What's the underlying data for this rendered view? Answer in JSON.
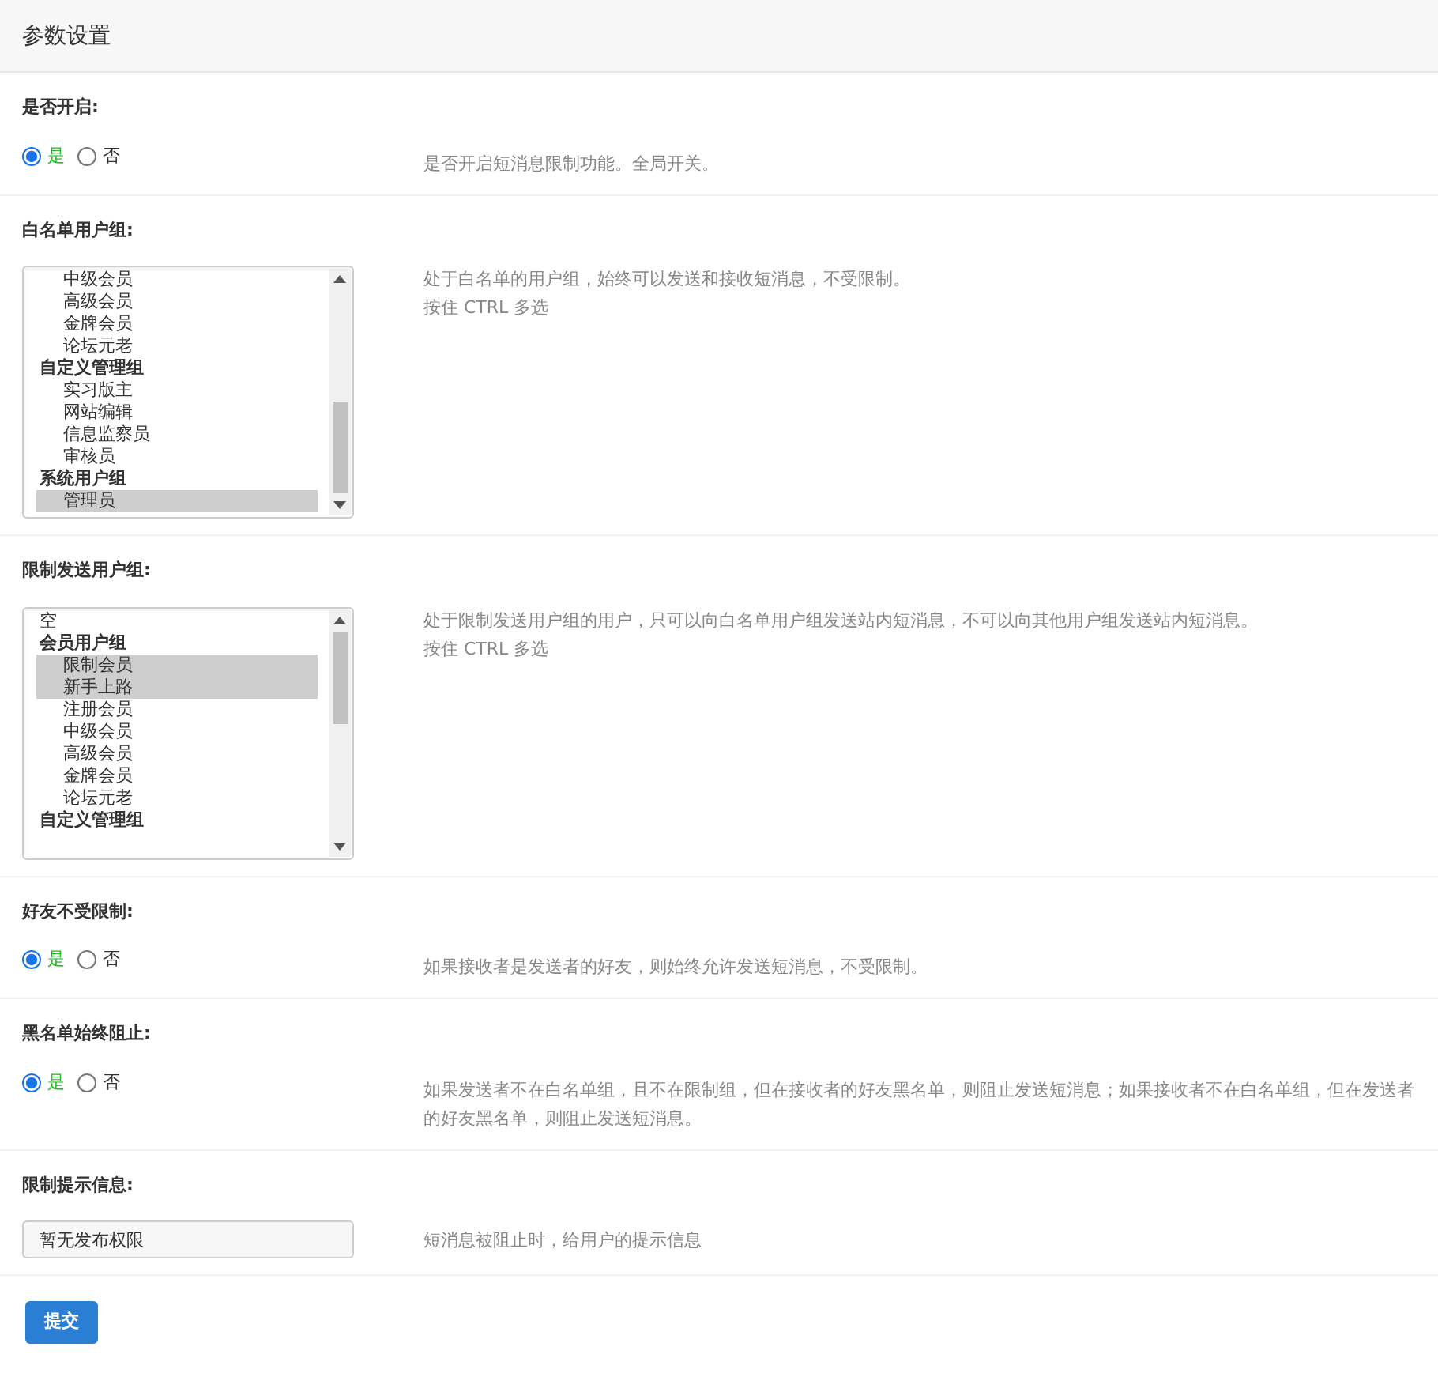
{
  "panel_title": "参数设置",
  "settings": [
    {
      "kind": "radio",
      "label": "是否开启:",
      "options": [
        {
          "label": "是",
          "selected": true
        },
        {
          "label": "否",
          "selected": false
        }
      ],
      "description": [
        "是否开启短消息限制功能。全局开关。"
      ]
    },
    {
      "kind": "listbox",
      "label": "白名单用户组:",
      "items": [
        {
          "kind": "option",
          "label": "中级会员",
          "selected": false
        },
        {
          "kind": "option",
          "label": "高级会员",
          "selected": false
        },
        {
          "kind": "option",
          "label": "金牌会员",
          "selected": false
        },
        {
          "kind": "option",
          "label": "论坛元老",
          "selected": false
        },
        {
          "kind": "group",
          "label": "自定义管理组",
          "selected": false
        },
        {
          "kind": "option",
          "label": "实习版主",
          "selected": false
        },
        {
          "kind": "option",
          "label": "网站编辑",
          "selected": false
        },
        {
          "kind": "option",
          "label": "信息监察员",
          "selected": false
        },
        {
          "kind": "option",
          "label": "审核员",
          "selected": false
        },
        {
          "kind": "group",
          "label": "系统用户组",
          "selected": false
        },
        {
          "kind": "option",
          "label": "管理员",
          "selected": true
        }
      ],
      "description": [
        "处于白名单的用户组，始终可以发送和接收短消息，不受限制。",
        "按住 CTRL 多选"
      ]
    },
    {
      "kind": "listbox",
      "label": "限制发送用户组:",
      "items": [
        {
          "kind": "plain",
          "label": "空",
          "selected": false
        },
        {
          "kind": "group",
          "label": "会员用户组",
          "selected": false
        },
        {
          "kind": "option",
          "label": "限制会员",
          "selected": true
        },
        {
          "kind": "option",
          "label": "新手上路",
          "selected": true
        },
        {
          "kind": "option",
          "label": "注册会员",
          "selected": false
        },
        {
          "kind": "option",
          "label": "中级会员",
          "selected": false
        },
        {
          "kind": "option",
          "label": "高级会员",
          "selected": false
        },
        {
          "kind": "option",
          "label": "金牌会员",
          "selected": false
        },
        {
          "kind": "option",
          "label": "论坛元老",
          "selected": false
        },
        {
          "kind": "group",
          "label": "自定义管理组",
          "selected": false
        }
      ],
      "description": [
        "处于限制发送用户组的用户，只可以向白名单用户组发送站内短消息，不可以向其他用户组发送站内短消息。",
        "按住 CTRL 多选"
      ]
    },
    {
      "kind": "radio",
      "label": "好友不受限制:",
      "options": [
        {
          "label": "是",
          "selected": true
        },
        {
          "label": "否",
          "selected": false
        }
      ],
      "description": [
        "如果接收者是发送者的好友，则始终允许发送短消息，不受限制。"
      ]
    },
    {
      "kind": "radio",
      "label": "黑名单始终阻止:",
      "options": [
        {
          "label": "是",
          "selected": true
        },
        {
          "label": "否",
          "selected": false
        }
      ],
      "description": [
        "如果发送者不在白名单组，且不在限制组，但在接收者的好友黑名单，则阻止发送短消息；如果接收者不在白名单组，但在发送者的好友黑名单，则阻止发送短消息。"
      ]
    },
    {
      "kind": "text",
      "label": "限制提示信息:",
      "value": "暂无发布权限",
      "description": [
        "短消息被阻止时，给用户的提示信息"
      ]
    }
  ],
  "submit_button": "提交"
}
